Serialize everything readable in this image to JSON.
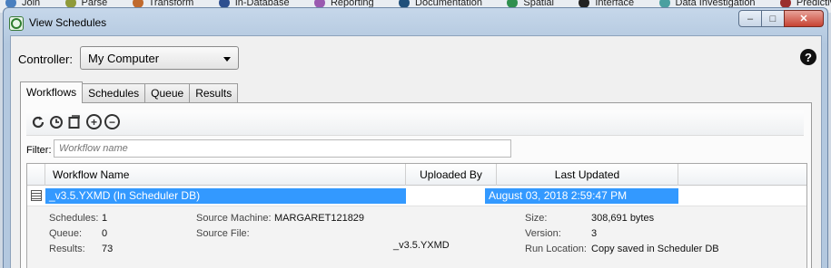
{
  "background_toolbar": {
    "tabs": [
      {
        "label": "Join",
        "color": "#4a7fbf"
      },
      {
        "label": "Parse",
        "color": "#8f9a3a"
      },
      {
        "label": "Transform",
        "color": "#c06a2e"
      },
      {
        "label": "In-Database",
        "color": "#2e4f8f"
      },
      {
        "label": "Reporting",
        "color": "#9a5ab0"
      },
      {
        "label": "Documentation",
        "color": "#1f4f7a"
      },
      {
        "label": "Spatial",
        "color": "#2f8f4f"
      },
      {
        "label": "Interface",
        "color": "#222222"
      },
      {
        "label": "Data Investigation",
        "color": "#4aa0a0"
      },
      {
        "label": "Predictive",
        "color": "#9a2e2e"
      }
    ]
  },
  "window": {
    "title": "View Schedules",
    "buttons": {
      "minimize": "–",
      "maximize": "□",
      "close": "✕"
    }
  },
  "controller": {
    "label": "Controller:",
    "selected": "My Computer"
  },
  "tabs": [
    {
      "label": "Workflows",
      "active": true
    },
    {
      "label": "Schedules",
      "active": false
    },
    {
      "label": "Queue",
      "active": false
    },
    {
      "label": "Results",
      "active": false
    }
  ],
  "toolbar": {
    "icons": [
      "refresh-icon",
      "schedule-icon",
      "edit-icon",
      "add-icon",
      "remove-icon"
    ]
  },
  "filter": {
    "label": "Filter:",
    "placeholder": "Workflow name",
    "value": ""
  },
  "grid": {
    "columns": [
      "Workflow Name",
      "Uploaded By",
      "Last Updated"
    ],
    "rows": [
      {
        "workflow_name": "_v3.5.YXMD (In Scheduler DB)",
        "uploaded_by": "",
        "last_updated": "August 03, 2018 2:59:47 PM"
      }
    ]
  },
  "details": {
    "schedules_label": "Schedules:",
    "schedules_value": "1",
    "queue_label": "Queue:",
    "queue_value": "0",
    "results_label": "Results:",
    "results_value": "73",
    "source_machine_label": "Source Machine:",
    "source_machine_value": "MARGARET121829",
    "source_file_label": "Source File:",
    "source_file_value": "_v3.5.YXMD",
    "size_label": "Size:",
    "size_value": "308,691 bytes",
    "version_label": "Version:",
    "version_value": "3",
    "run_location_label": "Run Location:",
    "run_location_value": "Copy saved in Scheduler DB"
  }
}
